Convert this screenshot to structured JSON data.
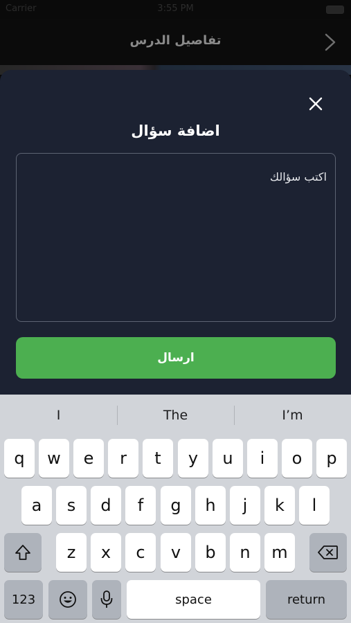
{
  "status_bar": {
    "carrier": "Carrier",
    "time": "3:55 PM"
  },
  "nav": {
    "title": "تفاصيل الدرس"
  },
  "sheet": {
    "title": "اضافة سؤال",
    "question_placeholder": "اكتب سؤالك",
    "send_label": "ارسال"
  },
  "keyboard": {
    "suggestions": [
      "I",
      "The",
      "I’m"
    ],
    "row1": [
      "q",
      "w",
      "e",
      "r",
      "t",
      "y",
      "u",
      "i",
      "o",
      "p"
    ],
    "row2": [
      "a",
      "s",
      "d",
      "f",
      "g",
      "h",
      "j",
      "k",
      "l"
    ],
    "row3": [
      "z",
      "x",
      "c",
      "v",
      "b",
      "n",
      "m"
    ],
    "numbers_label": "123",
    "space_label": "space",
    "return_label": "return"
  },
  "colors": {
    "sheet_bg": "#1c2232",
    "accent_green": "#4caf50",
    "keyboard_bg": "#d1d4d9"
  },
  "icons": {
    "back": "chevron-right-icon",
    "close": "close-icon",
    "shift": "shift-icon",
    "backspace": "backspace-icon",
    "emoji": "emoji-icon",
    "microphone": "microphone-icon"
  }
}
